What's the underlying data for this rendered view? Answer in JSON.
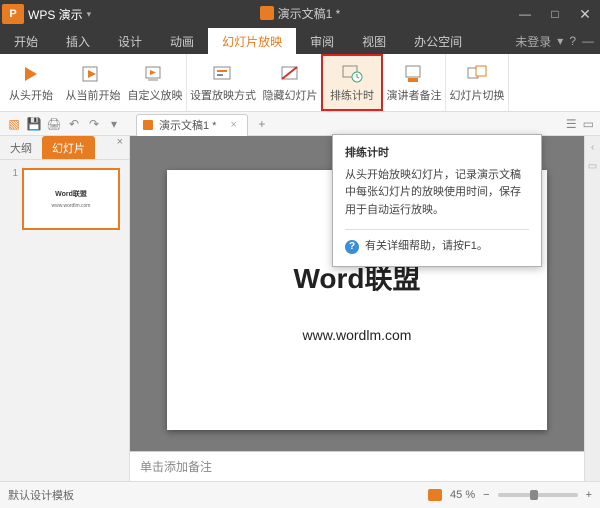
{
  "title": {
    "app_label": "P",
    "app_name": "WPS 演示",
    "doc_name": "演示文稿1 *"
  },
  "win": {
    "min": "—",
    "max": "□",
    "close": "✕"
  },
  "menu": {
    "tabs": [
      "开始",
      "插入",
      "设计",
      "动画",
      "幻灯片放映",
      "审阅",
      "视图",
      "办公空间"
    ],
    "active": 4,
    "login": "未登录",
    "caret": "▾",
    "q": "?",
    "opts": "—"
  },
  "ribbon": {
    "items": [
      {
        "label": "从头开始",
        "icon": "play"
      },
      {
        "label": "从当前开始",
        "icon": "play-cur"
      },
      {
        "label": "自定义放映",
        "icon": "custom"
      },
      {
        "label": "设置放映方式",
        "icon": "setup"
      },
      {
        "label": "隐藏幻灯片",
        "icon": "hide"
      },
      {
        "label": "排练计时",
        "icon": "rehearse"
      },
      {
        "label": "演讲者备注",
        "icon": "notes"
      },
      {
        "label": "幻灯片切换",
        "icon": "transition"
      }
    ],
    "highlight": 5
  },
  "qat": {
    "doc_tab": "演示文稿1 *",
    "close": "×",
    "add": "+"
  },
  "panel": {
    "tabs": [
      "大纲",
      "幻灯片"
    ],
    "active": 1,
    "close": "×"
  },
  "thumb": {
    "num": "1",
    "t1": "Word联盟",
    "t2": "www.wordlm.com"
  },
  "slide": {
    "title": "Word联盟",
    "url": "www.wordlm.com"
  },
  "notes": {
    "placeholder": "单击添加备注"
  },
  "status": {
    "template": "默认设计模板",
    "zoom": "45 %",
    "minus": "−",
    "plus": "+"
  },
  "tooltip": {
    "title": "排练计时",
    "body": "从头开始放映幻灯片，记录演示文稿中每张幻灯片的放映使用时间，保存用于自动运行放映。",
    "help": "有关详细帮助，请按F1。"
  },
  "icons": {
    "save": "💾",
    "print": "🖨",
    "undo": "↶",
    "redo": "↷",
    "caret": "▾",
    "doc": "▧",
    "sel": "☰",
    "slide": "▭"
  }
}
